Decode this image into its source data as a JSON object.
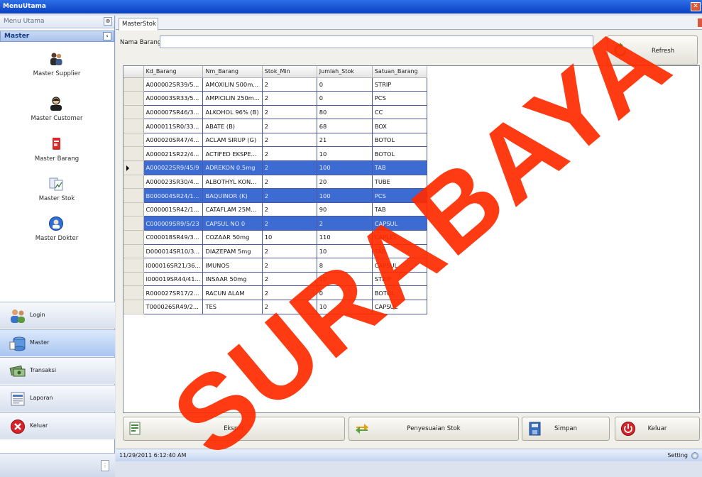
{
  "window": {
    "title": "MenuUtama"
  },
  "nav": {
    "header": "Menu Utama",
    "group_title": "Master",
    "items": [
      {
        "label": "Master Supplier",
        "icon": "users-icon"
      },
      {
        "label": "Master Customer",
        "icon": "customer-icon"
      },
      {
        "label": "Master Barang",
        "icon": "item-box-icon"
      },
      {
        "label": "Master Stok",
        "icon": "stock-chart-icon"
      },
      {
        "label": "Master Dokter",
        "icon": "doctor-icon"
      }
    ],
    "buttons": [
      {
        "label": "Login",
        "icon": "login-users-icon"
      },
      {
        "label": "Master",
        "icon": "master-db-icon",
        "active": true
      },
      {
        "label": "Transaksi",
        "icon": "transaction-icon"
      },
      {
        "label": "Laporan",
        "icon": "report-icon"
      },
      {
        "label": "Keluar",
        "icon": "exit-icon"
      }
    ]
  },
  "tab": {
    "label": "MasterStok"
  },
  "filter": {
    "label": "Nama Barang",
    "value": ""
  },
  "refresh": {
    "label": "Refresh"
  },
  "grid": {
    "columns": [
      "Kd_Barang",
      "Nm_Barang",
      "Stok_Min",
      "Jumlah_Stok",
      "Satuan_Barang"
    ],
    "rows": [
      {
        "cells": [
          "A000002SR39/5...",
          "AMOXILIN 500m...",
          "2",
          "0",
          "STRIP"
        ],
        "selected": false,
        "current": false
      },
      {
        "cells": [
          "A000003SR33/5...",
          "AMPICILIN 250m...",
          "2",
          "0",
          "PCS"
        ],
        "selected": false,
        "current": false
      },
      {
        "cells": [
          "A000007SR46/3...",
          "ALKOHOL 96% (B)",
          "2",
          "80",
          "CC"
        ],
        "selected": false,
        "current": false
      },
      {
        "cells": [
          "A000011SR0/33...",
          "ABATE (B)",
          "2",
          "68",
          "BOX"
        ],
        "selected": false,
        "current": false
      },
      {
        "cells": [
          "A000020SR47/4...",
          "ACLAM SIRUP (G)",
          "2",
          "21",
          "BOTOL"
        ],
        "selected": false,
        "current": false
      },
      {
        "cells": [
          "A000021SR22/4...",
          "ACTIFED EKSPE...",
          "2",
          "10",
          "BOTOL"
        ],
        "selected": false,
        "current": false
      },
      {
        "cells": [
          "A000022SR9/45/9",
          "ADREKON 0.5mg",
          "2",
          "100",
          "TAB"
        ],
        "selected": true,
        "current": true
      },
      {
        "cells": [
          "A000023SR30/4...",
          "ALBOTHYL KON...",
          "2",
          "20",
          "TUBE"
        ],
        "selected": false,
        "current": false
      },
      {
        "cells": [
          "B000004SR24/1...",
          "BAQUINOR (K)",
          "2",
          "100",
          "PCS"
        ],
        "selected": true,
        "current": false
      },
      {
        "cells": [
          "C000001SR42/1...",
          "CATAFLAM 25M...",
          "2",
          "90",
          "TAB"
        ],
        "selected": false,
        "current": false
      },
      {
        "cells": [
          "C000009SR9/5/23",
          "CAPSUL NO 0",
          "2",
          "2",
          "CAPSUL"
        ],
        "selected": true,
        "current": false
      },
      {
        "cells": [
          "C000018SR49/3...",
          "COZAAR 50mg",
          "10",
          "110",
          "CAPLET"
        ],
        "selected": false,
        "current": false
      },
      {
        "cells": [
          "D000014SR10/3...",
          "DIAZEPAM 5mg",
          "2",
          "10",
          "TAB"
        ],
        "selected": false,
        "current": false
      },
      {
        "cells": [
          "I000016SR21/36...",
          "IMUNOS",
          "2",
          "8",
          "CAPSUL"
        ],
        "selected": false,
        "current": false
      },
      {
        "cells": [
          "I000019SR44/41...",
          "INSAAR 50mg",
          "2",
          "10",
          "STRIP"
        ],
        "selected": false,
        "current": false
      },
      {
        "cells": [
          "R000027SR17/2...",
          "RACUN ALAM",
          "2",
          "0",
          "BOTOL"
        ],
        "selected": false,
        "current": false
      },
      {
        "cells": [
          "T000026SR49/2...",
          "TES",
          "2",
          "10",
          "CAPSUL"
        ],
        "selected": false,
        "current": false
      }
    ]
  },
  "actions": {
    "ekspor": "Ekspor",
    "penyesuaian": "Penyesuaian Stok",
    "simpan": "Simpan",
    "keluar": "Keluar"
  },
  "status": {
    "datetime": "11/29/2011 6:12:40 AM",
    "setting": "Setting"
  },
  "watermark": {
    "text": "SURABAYA",
    "color": "#ff2a00"
  }
}
